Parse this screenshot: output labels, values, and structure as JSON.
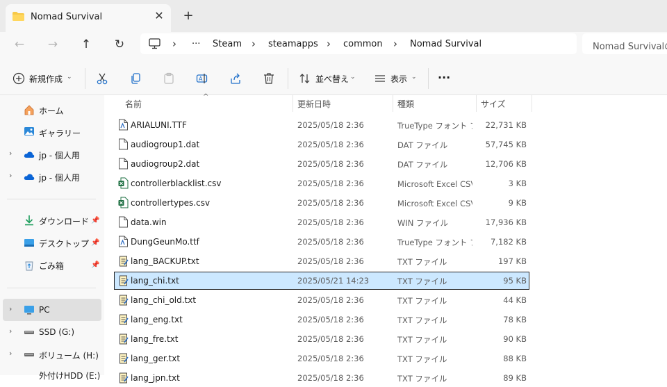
{
  "window": {
    "tab_title": "Nomad Survival",
    "tab_close": "✕",
    "new_tab": "+"
  },
  "nav": {
    "back": "←",
    "forward": "→",
    "up": "↑",
    "refresh": "↻"
  },
  "address": {
    "more": "···",
    "sep": "›",
    "crumbs": [
      "Steam",
      "steamapps",
      "common",
      "Nomad Survival"
    ]
  },
  "search": {
    "placeholder": "Nomad Survivalの"
  },
  "toolbar": {
    "new_label": "新規作成",
    "sort_label": "並べ替え",
    "view_label": "表示",
    "more": "···",
    "chevron": "⌄"
  },
  "sidebar": {
    "items": [
      {
        "label": "ホーム"
      },
      {
        "label": "ギャラリー"
      },
      {
        "label": "jp - 個人用"
      },
      {
        "label": "jp - 個人用"
      },
      {
        "label": "ダウンロード"
      },
      {
        "label": "デスクトップ"
      },
      {
        "label": "ごみ箱"
      },
      {
        "label": "PC"
      },
      {
        "label": "SSD (G:)"
      },
      {
        "label": "ボリューム (H:)"
      },
      {
        "label": "外付けHDD (E:)"
      }
    ],
    "expand_glyph": "›",
    "pin_glyph": "📌"
  },
  "list": {
    "columns": [
      "名前",
      "更新日時",
      "種類",
      "サイズ"
    ],
    "sort_indicator": "^",
    "files": [
      {
        "name": "ARIALUNI.TTF",
        "date": "2025/05/18 2:36",
        "type": "TrueType フォント ファイル",
        "size": "22,731 KB",
        "icon": "font-file-icon"
      },
      {
        "name": "audiogroup1.dat",
        "date": "2025/05/18 2:36",
        "type": "DAT ファイル",
        "size": "57,745 KB",
        "icon": "generic-file-icon"
      },
      {
        "name": "audiogroup2.dat",
        "date": "2025/05/18 2:36",
        "type": "DAT ファイル",
        "size": "12,706 KB",
        "icon": "generic-file-icon"
      },
      {
        "name": "controllerblacklist.csv",
        "date": "2025/05/18 2:36",
        "type": "Microsoft Excel CSV ファイル",
        "size": "3 KB",
        "icon": "excel-file-icon"
      },
      {
        "name": "controllertypes.csv",
        "date": "2025/05/18 2:36",
        "type": "Microsoft Excel CSV ファイル",
        "size": "9 KB",
        "icon": "excel-file-icon"
      },
      {
        "name": "data.win",
        "date": "2025/05/18 2:36",
        "type": "WIN ファイル",
        "size": "17,936 KB",
        "icon": "generic-file-icon"
      },
      {
        "name": "DungGeunMo.ttf",
        "date": "2025/05/18 2:36",
        "type": "TrueType フォント ファイル",
        "size": "7,182 KB",
        "icon": "font-file-icon"
      },
      {
        "name": "lang_BACKUP.txt",
        "date": "2025/05/18 2:36",
        "type": "TXT ファイル",
        "size": "197 KB",
        "icon": "text-file-icon"
      },
      {
        "name": "lang_chi.txt",
        "date": "2025/05/21 14:23",
        "type": "TXT ファイル",
        "size": "95 KB",
        "icon": "text-file-icon",
        "selected": true
      },
      {
        "name": "lang_chi_old.txt",
        "date": "2025/05/18 2:36",
        "type": "TXT ファイル",
        "size": "44 KB",
        "icon": "text-file-icon"
      },
      {
        "name": "lang_eng.txt",
        "date": "2025/05/18 2:36",
        "type": "TXT ファイル",
        "size": "78 KB",
        "icon": "text-file-icon"
      },
      {
        "name": "lang_fre.txt",
        "date": "2025/05/18 2:36",
        "type": "TXT ファイル",
        "size": "90 KB",
        "icon": "text-file-icon"
      },
      {
        "name": "lang_ger.txt",
        "date": "2025/05/18 2:36",
        "type": "TXT ファイル",
        "size": "88 KB",
        "icon": "text-file-icon"
      },
      {
        "name": "lang_jpn.txt",
        "date": "2025/05/18 2:36",
        "type": "TXT ファイル",
        "size": "89 KB",
        "icon": "text-file-icon"
      }
    ]
  },
  "colors": {
    "accent": "#0067c0",
    "selection": "#cce8ff",
    "folder": "#f7c948",
    "excel": "#1d6f42"
  }
}
